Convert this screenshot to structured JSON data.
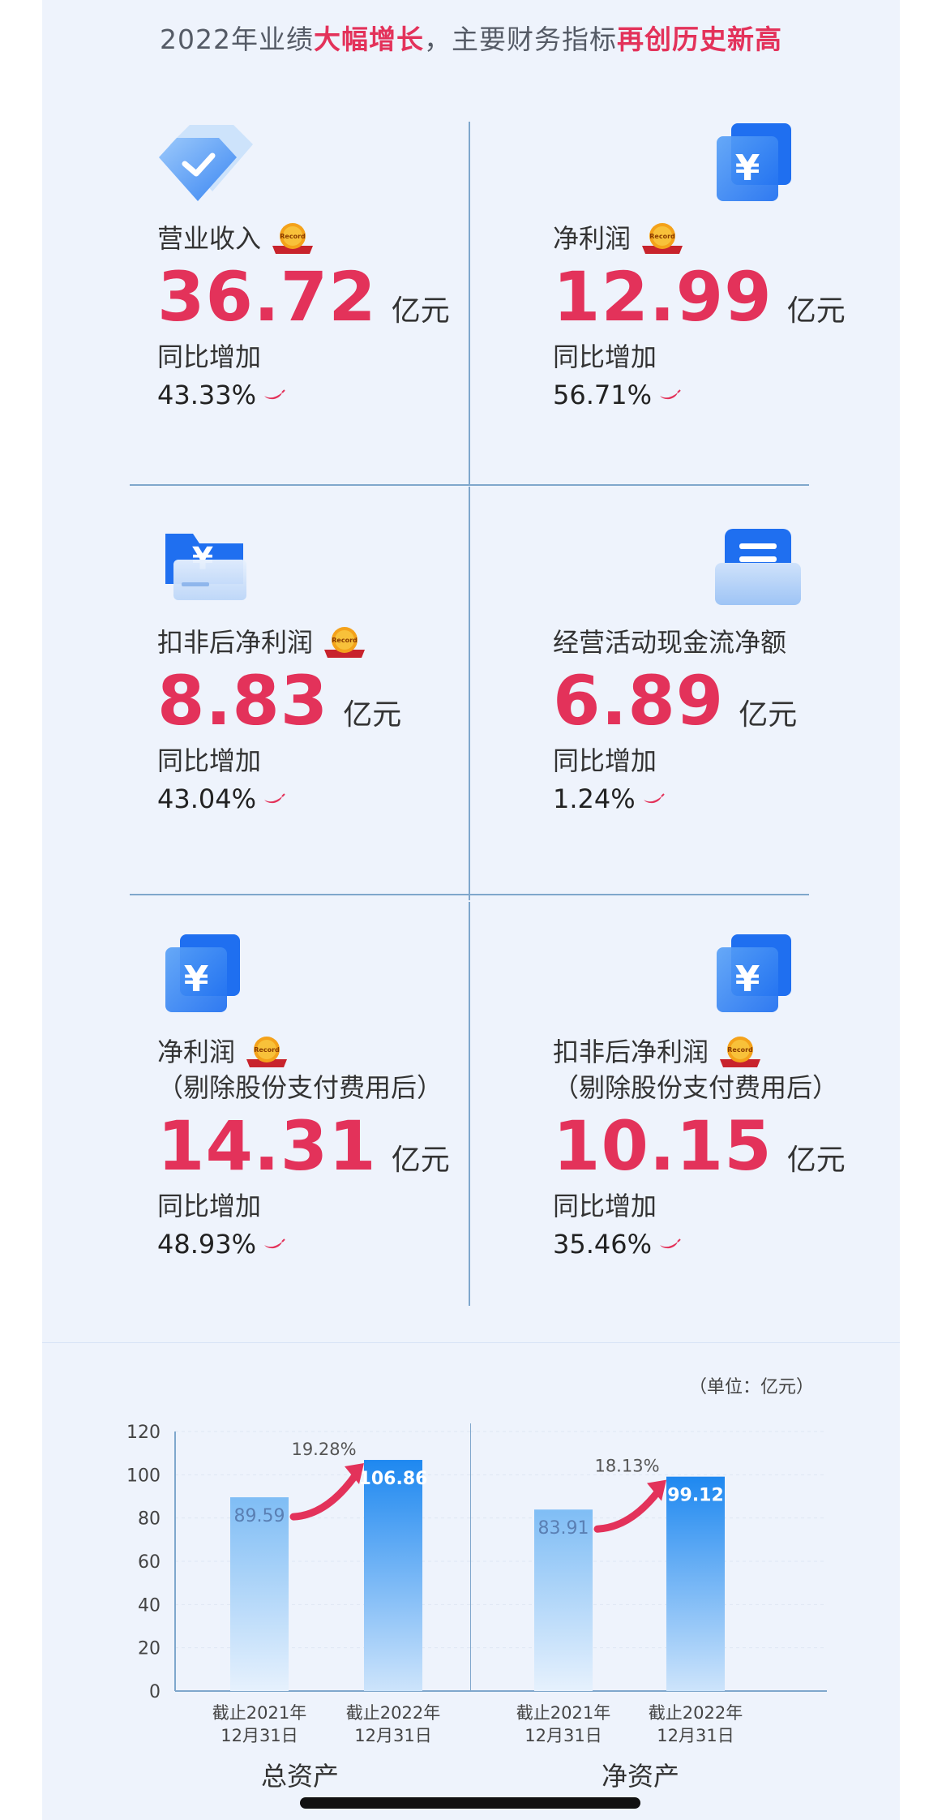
{
  "headline": {
    "p1": "2022年业绩",
    "h1": "大幅增长",
    "p2": "，主要财务指标",
    "h2": "再创历史新高"
  },
  "metrics": [
    {
      "label": "营业收入",
      "label2": "",
      "value": "36.72",
      "unit": "亿元",
      "yoy_label": "同比增加",
      "yoy": "43.33%",
      "icon": "diamond-check-icon",
      "record": true
    },
    {
      "label": "净利润",
      "label2": "",
      "value": "12.99",
      "unit": "亿元",
      "yoy_label": "同比增加",
      "yoy": "56.71%",
      "icon": "yuan-document-icon",
      "record": true
    },
    {
      "label": "扣非后净利润",
      "label2": "",
      "value": "8.83",
      "unit": "亿元",
      "yoy_label": "同比增加",
      "yoy": "43.04%",
      "icon": "yuan-folder-icon",
      "record": true
    },
    {
      "label": "经营活动现金流净额",
      "label2": "",
      "value": "6.89",
      "unit": "亿元",
      "yoy_label": "同比增加",
      "yoy": "1.24%",
      "icon": "cash-tray-icon",
      "record": false
    },
    {
      "label": "净利润",
      "label2": "（剔除股份支付费用后）",
      "value": "14.31",
      "unit": "亿元",
      "yoy_label": "同比增加",
      "yoy": "48.93%",
      "icon": "yuan-document-icon",
      "record": true
    },
    {
      "label": "扣非后净利润",
      "label2": "（剔除股份支付费用后）",
      "value": "10.15",
      "unit": "亿元",
      "yoy_label": "同比增加",
      "yoy": "35.46%",
      "icon": "yuan-document-icon",
      "record": true
    }
  ],
  "record_badge": "Record",
  "unit_note": "（单位：亿元）",
  "colors": {
    "accent": "#e3325a",
    "blue": "#1a5ef2",
    "bar_dark": "#1e88f0",
    "bar_light": "#7fbdf5"
  },
  "chart_data": [
    {
      "type": "bar",
      "title": "总资产",
      "categories": [
        "截止2021年\n12月31日",
        "截止2022年\n12月31日"
      ],
      "values": [
        89.59,
        106.86
      ],
      "ylim": [
        0,
        120
      ],
      "yticks": [
        0,
        20,
        40,
        60,
        80,
        100,
        120
      ],
      "growth": "19.28%",
      "grid": true
    },
    {
      "type": "bar",
      "title": "净资产",
      "categories": [
        "截止2021年\n12月31日",
        "截止2022年\n12月31日"
      ],
      "values": [
        83.91,
        99.12
      ],
      "ylim": [
        0,
        120
      ],
      "yticks": [],
      "growth": "18.13%",
      "grid": true
    }
  ]
}
